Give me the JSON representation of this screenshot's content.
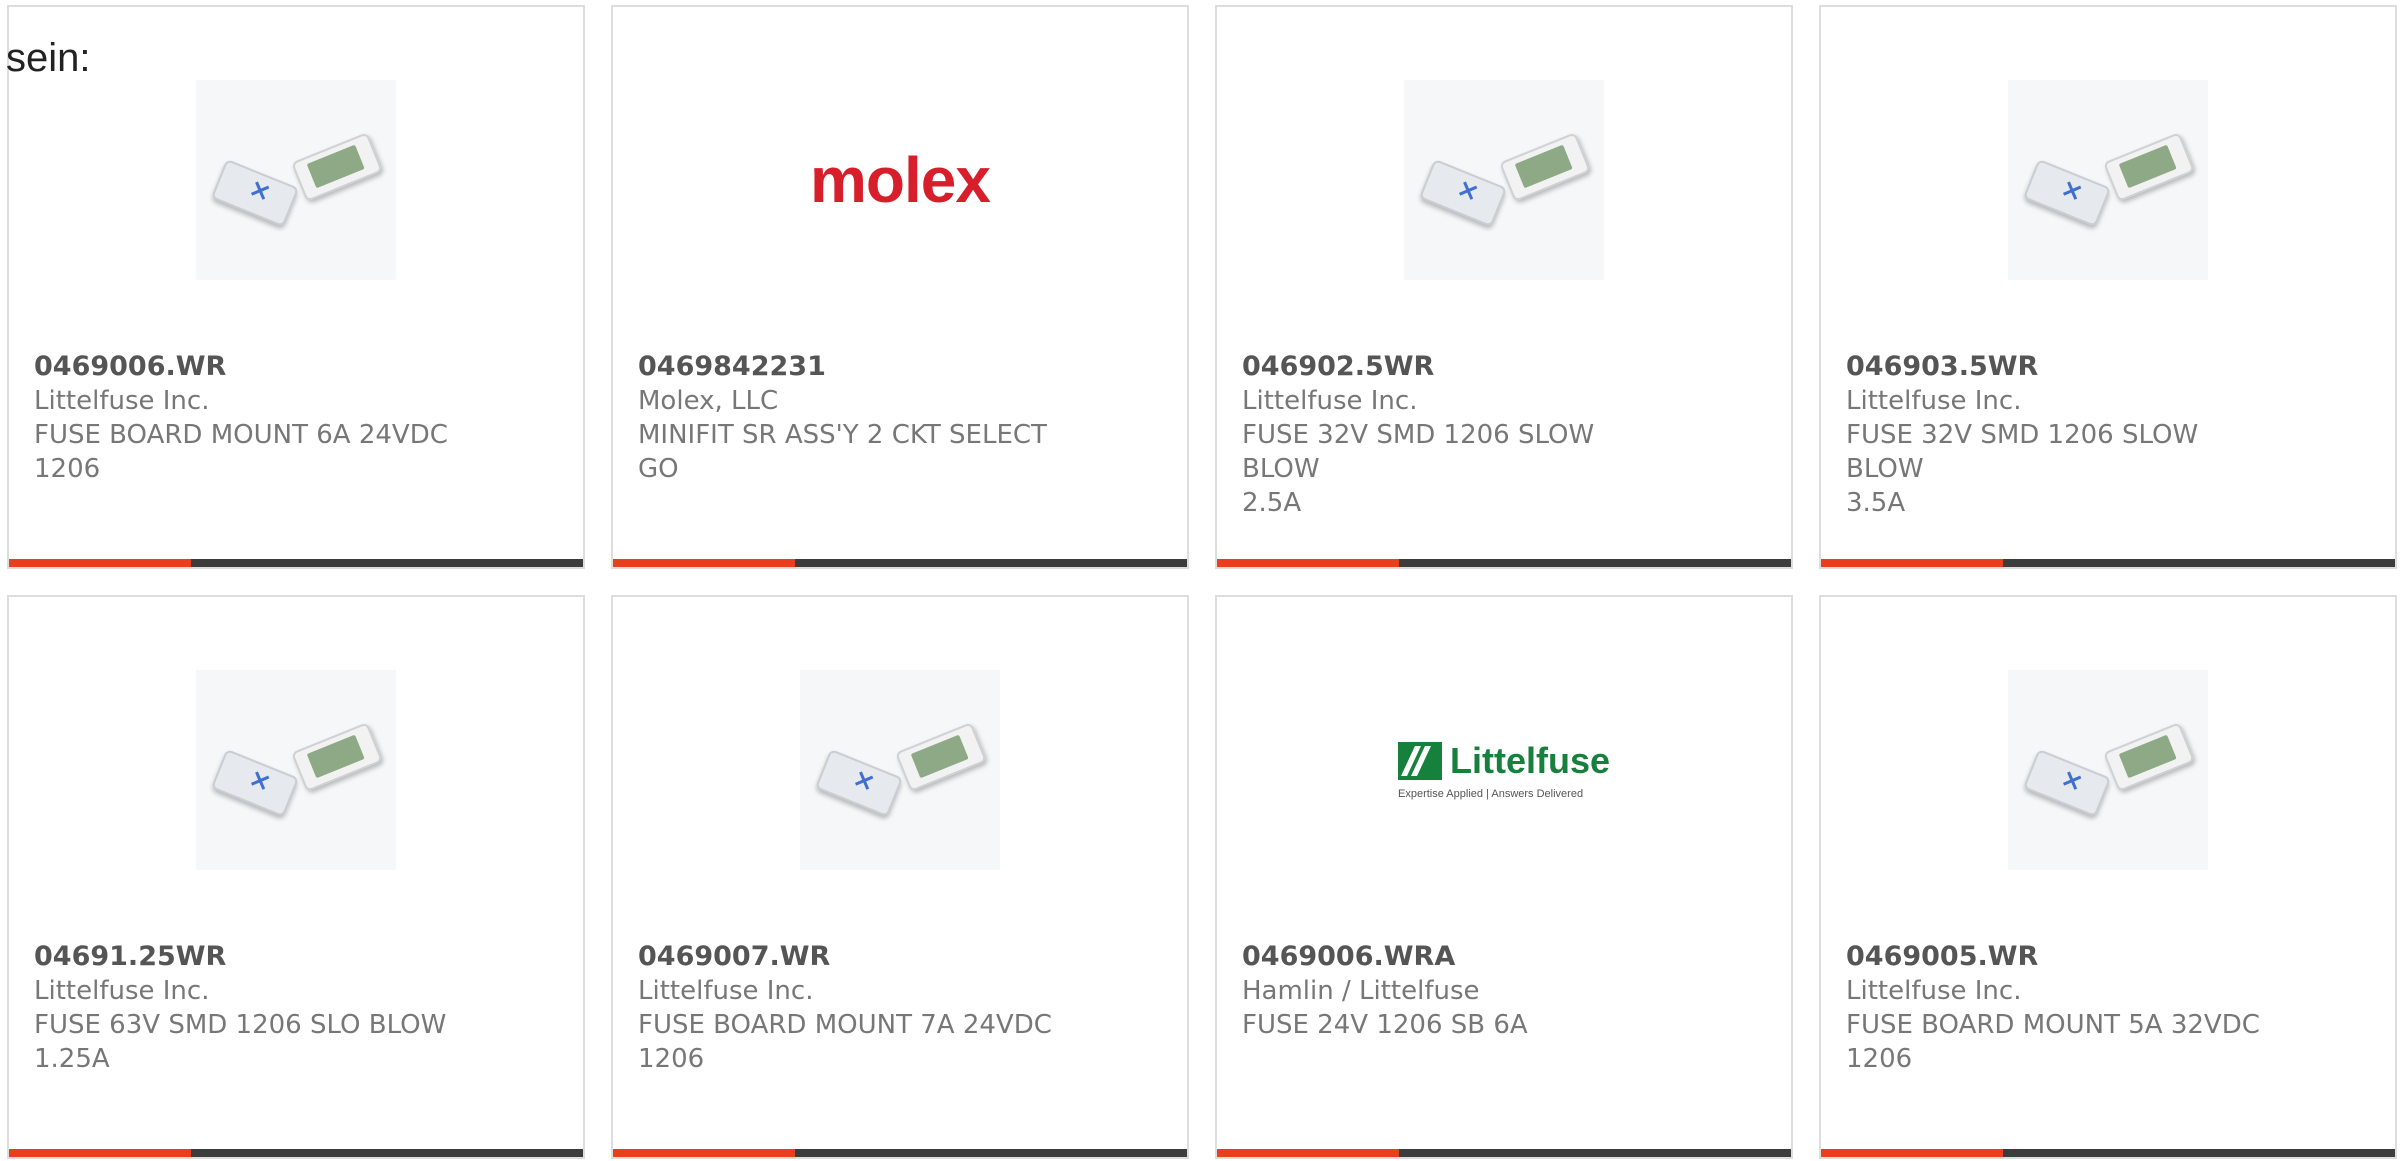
{
  "lead_text": "sein:",
  "products": [
    {
      "part_number": "0469006.WR",
      "manufacturer": "Littelfuse Inc.",
      "desc_line1": "FUSE BOARD MOUNT 6A 24VDC",
      "desc_line2": "1206",
      "image": "fuse-chip-photo"
    },
    {
      "part_number": "0469842231",
      "manufacturer": "Molex, LLC",
      "desc_line1": "MINIFIT SR ASS'Y 2 CKT SELECT",
      "desc_line2": "GO",
      "image": "molex-logo",
      "logo_text": "molex"
    },
    {
      "part_number": "046902.5WR",
      "manufacturer": "Littelfuse Inc.",
      "desc_line1": "FUSE 32V SMD 1206 SLOW BLOW",
      "desc_line2": "2.5A",
      "image": "fuse-chip-photo"
    },
    {
      "part_number": "046903.5WR",
      "manufacturer": "Littelfuse Inc.",
      "desc_line1": "FUSE 32V SMD 1206 SLOW BLOW",
      "desc_line2": "3.5A",
      "image": "fuse-chip-photo"
    },
    {
      "part_number": "04691.25WR",
      "manufacturer": "Littelfuse Inc.",
      "desc_line1": "FUSE 63V SMD 1206 SLO BLOW",
      "desc_line2": "1.25A",
      "image": "fuse-chip-photo"
    },
    {
      "part_number": "0469007.WR",
      "manufacturer": "Littelfuse Inc.",
      "desc_line1": "FUSE BOARD MOUNT 7A 24VDC",
      "desc_line2": "1206",
      "image": "fuse-chip-photo"
    },
    {
      "part_number": "0469006.WRA",
      "manufacturer": "Hamlin / Littelfuse",
      "desc_line1": "FUSE 24V 1206 SB 6A",
      "desc_line2": "",
      "image": "littelfuse-logo",
      "logo_text": "Littelfuse",
      "logo_tagline": "Expertise Applied | Answers Delivered"
    },
    {
      "part_number": "0469005.WR",
      "manufacturer": "Littelfuse Inc.",
      "desc_line1": "FUSE BOARD MOUNT 5A 32VDC",
      "desc_line2": "1206",
      "image": "fuse-chip-photo"
    }
  ],
  "colors": {
    "accent": "#e8401c",
    "bar": "#3c3c3c",
    "border": "#dddddd",
    "molex_red": "#d71e2b",
    "littelfuse_green": "#15813d"
  }
}
